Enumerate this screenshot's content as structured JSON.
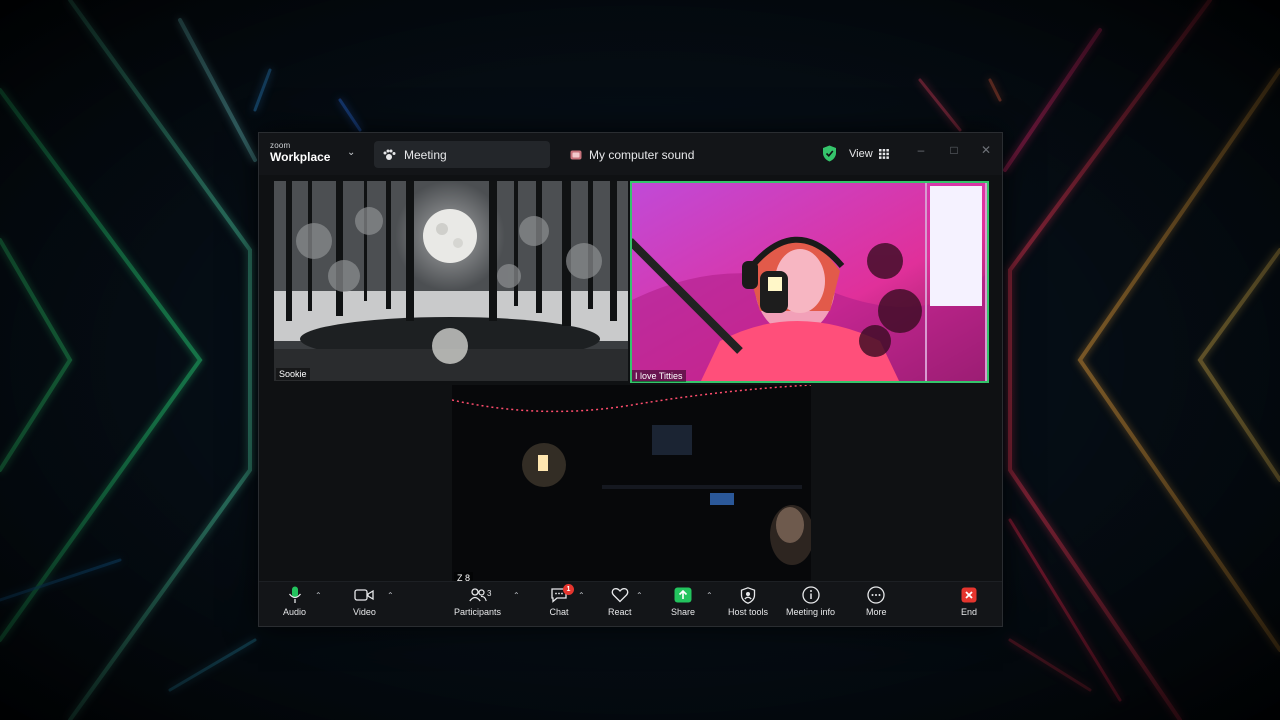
{
  "app": {
    "logo_top": "zoom",
    "logo_main": "Workplace",
    "tabs": [
      {
        "label": "Meeting",
        "icon": "meeting-paw-icon",
        "active": true
      },
      {
        "label": "My computer sound",
        "icon": "computer-sound-icon",
        "active": false
      }
    ],
    "view_label": "View",
    "shield_color": "#35c46b"
  },
  "tiles": [
    {
      "label": "Sookie",
      "scene": "moonlit snowy forest"
    },
    {
      "label": "I love Titties",
      "active_speaker": true,
      "accent": "#35c46b"
    },
    {
      "label": "Z 8"
    }
  ],
  "toolbar": {
    "audio": "Audio",
    "video": "Video",
    "participants": "Participants",
    "participants_count": "3",
    "chat": "Chat",
    "chat_badge": "1",
    "react": "React",
    "share": "Share",
    "host_tools": "Host tools",
    "meeting_info": "Meeting info",
    "more": "More",
    "end": "End",
    "share_color": "#23c45e",
    "end_color": "#e5352e",
    "mic_color": "#23c45e"
  }
}
